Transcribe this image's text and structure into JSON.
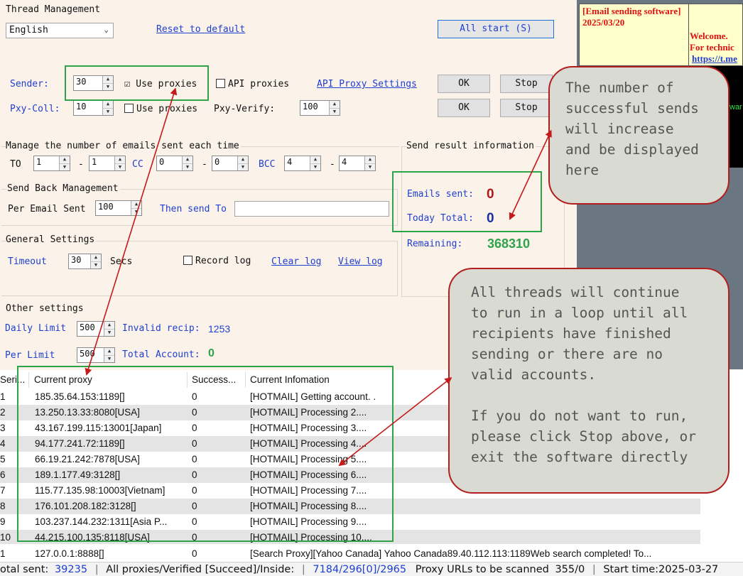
{
  "thread_panel": {
    "title": "Thread Management",
    "language": "English",
    "reset_link": "Reset to default",
    "all_start": "All start (S)",
    "sender_label": "Sender:",
    "sender_value": "30",
    "use_proxies_1": "Use proxies",
    "use_proxies_1_checked": "☑",
    "api_proxies": "API proxies",
    "api_proxy_settings": "API Proxy Settings",
    "ok1": "OK",
    "stop1": "Stop",
    "pxy_coll_label": "Pxy-Coll:",
    "pxy_coll_value": "10",
    "use_proxies_2": "Use proxies",
    "pxy_verify_label": "Pxy-Verify:",
    "pxy_verify_value": "100",
    "ok2": "OK",
    "stop2": "Stop"
  },
  "emails_each": {
    "title": "Manage the number of emails sent each time",
    "to_label": "TO",
    "to_min": "1",
    "to_max": "1",
    "dash": "-",
    "cc_label": "CC",
    "cc_min": "0",
    "cc_max": "0",
    "bcc_label": "BCC",
    "bcc_min": "4",
    "bcc_max": "4"
  },
  "send_back": {
    "title": "Send Back Management",
    "per_email_label": "Per Email Sent",
    "per_email_value": "100",
    "then_send_label": "Then send To",
    "then_send_value": ""
  },
  "result_info": {
    "title": "Send result information",
    "emails_sent_label": "Emails sent:",
    "emails_sent_value": "0",
    "today_total_label": "Today Total:",
    "today_total_value": "0",
    "remaining_label": "Remaining:",
    "remaining_value": "368310"
  },
  "general": {
    "title": "General Settings",
    "timeout_label": "Timeout",
    "timeout_value": "30",
    "secs_label": "Secs",
    "record_log": "Record log",
    "clear_log": "Clear log",
    "view_log": "View log"
  },
  "other": {
    "title": "Other settings",
    "daily_limit_label": "Daily Limit",
    "daily_limit_value": "500",
    "invalid_recip_label": "Invalid recip:",
    "invalid_recip_value": "1253",
    "per_limit_label": "Per Limit",
    "per_limit_value": "500",
    "total_account_label": "Total Account:",
    "total_account_value": "0"
  },
  "banner": {
    "left_text": "[Email sending software]\n2025/03/20",
    "welcome": "Welcome.",
    "tech": "For technic",
    "link": "https://t.me",
    "green_fragment": "war"
  },
  "table": {
    "headers": [
      "Seri...",
      "Current proxy",
      "Success...",
      "Current Infomation"
    ],
    "rows": [
      {
        "num": "1",
        "proxy": "185.35.64.153:1189[]",
        "success": "0",
        "info": "[HOTMAIL] Getting account. ."
      },
      {
        "num": "2",
        "proxy": "13.250.13.33:8080[USA]",
        "success": "0",
        "info": "[HOTMAIL] Processing 2...."
      },
      {
        "num": "3",
        "proxy": "43.167.199.115:13001[Japan]",
        "success": "0",
        "info": "[HOTMAIL] Processing 3...."
      },
      {
        "num": "4",
        "proxy": "94.177.241.72:1189[]",
        "success": "0",
        "info": "[HOTMAIL] Processing 4...."
      },
      {
        "num": "5",
        "proxy": "66.19.21.242:7878[USA]",
        "success": "0",
        "info": "[HOTMAIL] Processing 5...."
      },
      {
        "num": "6",
        "proxy": "189.1.177.49:3128[]",
        "success": "0",
        "info": "[HOTMAIL] Processing 6...."
      },
      {
        "num": "7",
        "proxy": "115.77.135.98:10003[Vietnam]",
        "success": "0",
        "info": "[HOTMAIL] Processing 7...."
      },
      {
        "num": "8",
        "proxy": "176.101.208.182:3128[]",
        "success": "0",
        "info": "[HOTMAIL] Processing 8...."
      },
      {
        "num": "9",
        "proxy": "103.237.144.232:1311[Asia P...",
        "success": "0",
        "info": "[HOTMAIL] Processing 9...."
      },
      {
        "num": "10",
        "proxy": "44.215.100.135:8118[USA]",
        "success": "0",
        "info": "[HOTMAIL] Processing 10...."
      },
      {
        "num": "1",
        "proxy": "127.0.0.1:8888[]",
        "success": "0",
        "info": "[Search Proxy][Yahoo Canada] Yahoo Canada89.40.112.113:1189Web search completed! To..."
      }
    ]
  },
  "callouts": {
    "top": "The number of\nsuccessful sends\nwill increase\nand be displayed\nhere",
    "bottom": "All threads will continue\nto run in a loop until all\nrecipients have finished\nsending or there are no\nvalid accounts.\n\nIf you do not want to run,\nplease click Stop above, or\nexit the software directly"
  },
  "status": {
    "total_sent_label": "otal sent:",
    "total_sent_value": "39235",
    "sep": "|",
    "proxies_label": "All proxies/Verified [Succeed]/Inside:",
    "proxies_value": "7184/296[0]/2965",
    "urls_label": "Proxy URLs to be scanned",
    "urls_value": "355/0",
    "start_label": "Start time:2025-03-27"
  },
  "colors": {
    "accent_blue": "#1e3fd0",
    "highlight_green": "#2ea34a",
    "callout_border": "#b21d1d",
    "emails_sent_red": "#b01818",
    "remaining_green": "#2ea34a"
  }
}
